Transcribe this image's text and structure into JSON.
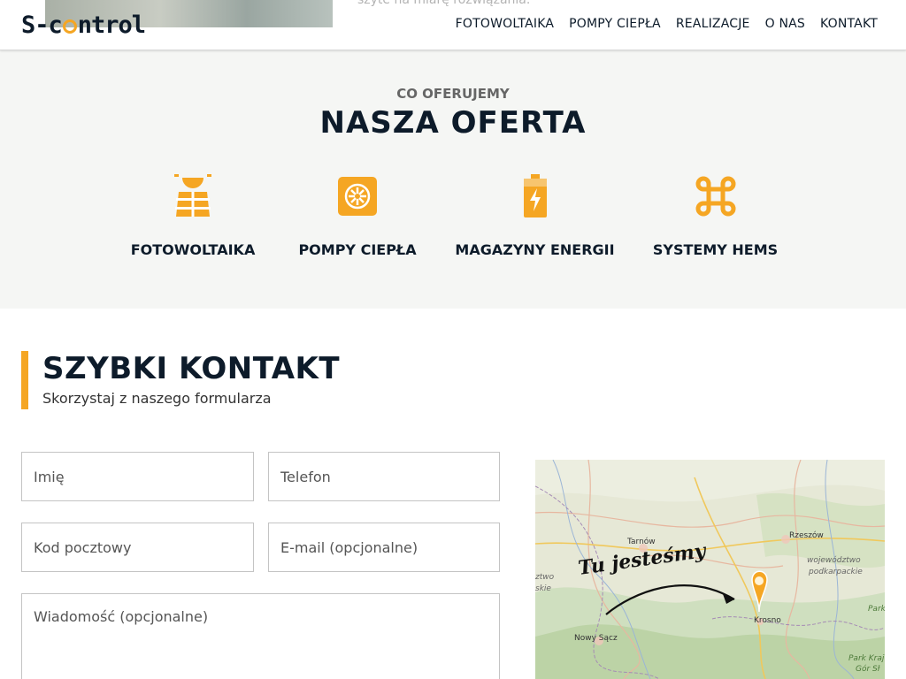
{
  "hero": {
    "text": "szyte na miarę rozwiązania."
  },
  "header": {
    "logo_left": "S-c",
    "logo_right": "ntrol",
    "nav": [
      {
        "label": "FOTOWOLTAIKA"
      },
      {
        "label": "POMPY CIEPŁA"
      },
      {
        "label": "REALIZACJE"
      },
      {
        "label": "O NAS"
      },
      {
        "label": "KONTAKT"
      }
    ]
  },
  "offer": {
    "kicker": "CO OFERUJEMY",
    "title": "NASZA OFERTA",
    "items": [
      {
        "label": "FOTOWOLTAIKA",
        "icon": "solar-panel-icon"
      },
      {
        "label": "POMPY CIEPŁA",
        "icon": "heat-pump-icon"
      },
      {
        "label": "MAGAZYNY ENERGII",
        "icon": "battery-icon"
      },
      {
        "label": "SYSTEMY HEMS",
        "icon": "command-icon"
      }
    ]
  },
  "contact": {
    "title": "SZYBKI KONTAKT",
    "subtitle": "Skorzystaj z naszego formularza",
    "fields": {
      "name": "Imię",
      "phone": "Telefon",
      "postal": "Kod pocztowy",
      "email": "E-mail (opcjonalne)",
      "message": "Wiadomość (opcjonalne)"
    }
  },
  "map": {
    "annotation": "Tu jesteśmy",
    "labels": {
      "tarnow": "Tarnów",
      "rzeszow": "Rzeszów",
      "woj1": "województwo",
      "woj2": "podkarpackie",
      "krosno": "Krosno",
      "nowy_sacz": "Nowy Sącz",
      "left1": "ztwo",
      "left2": "skie",
      "park1": "Park",
      "park2": "Park Kraj",
      "park3": "Gór Sł"
    }
  },
  "colors": {
    "accent": "#f5a623",
    "navy": "#0d1b2a",
    "offer_bg": "#f5f6f4"
  }
}
